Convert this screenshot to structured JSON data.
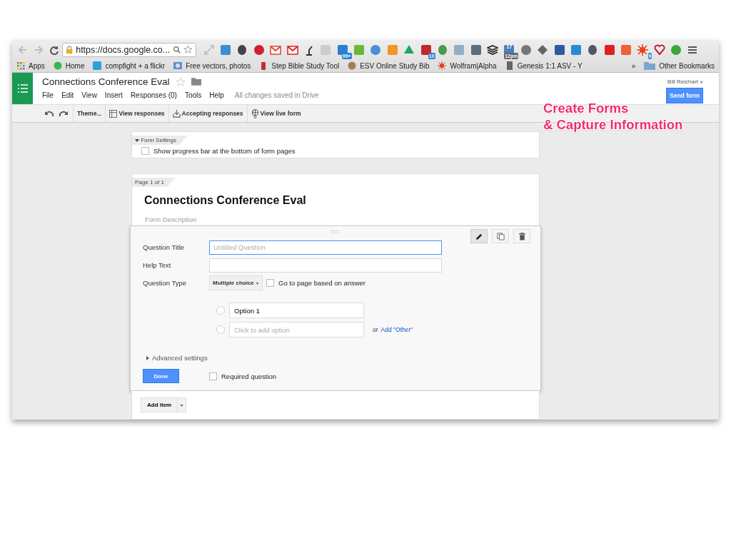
{
  "browser": {
    "url": "https://docs.google.co...",
    "extension_badges": [
      "99+",
      "10",
      "17",
      "12pm",
      "9"
    ],
    "bookmarks": [
      {
        "kind": "grid",
        "label": "Apps"
      },
      {
        "kind": "globe",
        "label": "Home"
      },
      {
        "kind": "letter",
        "label": "compfight + a flickr"
      },
      {
        "kind": "photo",
        "label": "Free vectors, photos"
      },
      {
        "kind": "bottle",
        "label": "Step Bible Study Tool"
      },
      {
        "kind": "seal",
        "label": "ESV Online Study Bib"
      },
      {
        "kind": "sun",
        "label": "Wolfram|Alpha"
      },
      {
        "kind": "book",
        "label": "Genesis 1:1 ASV - Y"
      }
    ],
    "overflow": "»",
    "other_bookmarks": "Other Bookmarks"
  },
  "doc": {
    "title": "Connections Conference Eval",
    "starred": false,
    "menus": [
      "File",
      "Edit",
      "View",
      "Insert",
      "Responses (0)",
      "Tools",
      "Help"
    ],
    "save_status": "All changes saved in Drive",
    "user": "Bill Reichart",
    "send_button": "Send form"
  },
  "toolbar": [
    {
      "kind": "theme",
      "label": "Theme..."
    },
    {
      "kind": "table",
      "label": "View responses"
    },
    {
      "kind": "inbox",
      "label": "Accepting responses"
    },
    {
      "kind": "globe",
      "label": "View live form"
    }
  ],
  "form_settings": {
    "title": "Form Settings",
    "expanded": true,
    "progress_label": "Show progress bar at the bottom of form pages",
    "progress_checked": false
  },
  "page": {
    "label": "Page 1 of 1",
    "title": "Connections Conference Eval",
    "description_placeholder": "Form Description"
  },
  "question": {
    "title_label": "Question Title",
    "title_placeholder": "Untitled Question",
    "help_label": "Help Text",
    "type_label": "Question Type",
    "type_value": "Multiple choice",
    "go_to_page_label": "Go to page based on answer",
    "go_to_page_checked": false,
    "options": [
      {
        "value": "Option 1",
        "selected": false
      }
    ],
    "add_option_selected": false,
    "add_option_placeholder": "Click to add option",
    "other_prefix": "or",
    "other_link": "Add \"Other\"",
    "advanced_label": "Advanced settings",
    "advanced_expanded": false,
    "done": "Done",
    "required_label": "Required question",
    "required_checked": false
  },
  "add_item": "Add item",
  "caption": [
    "Create Forms",
    "& Capture Information"
  ]
}
